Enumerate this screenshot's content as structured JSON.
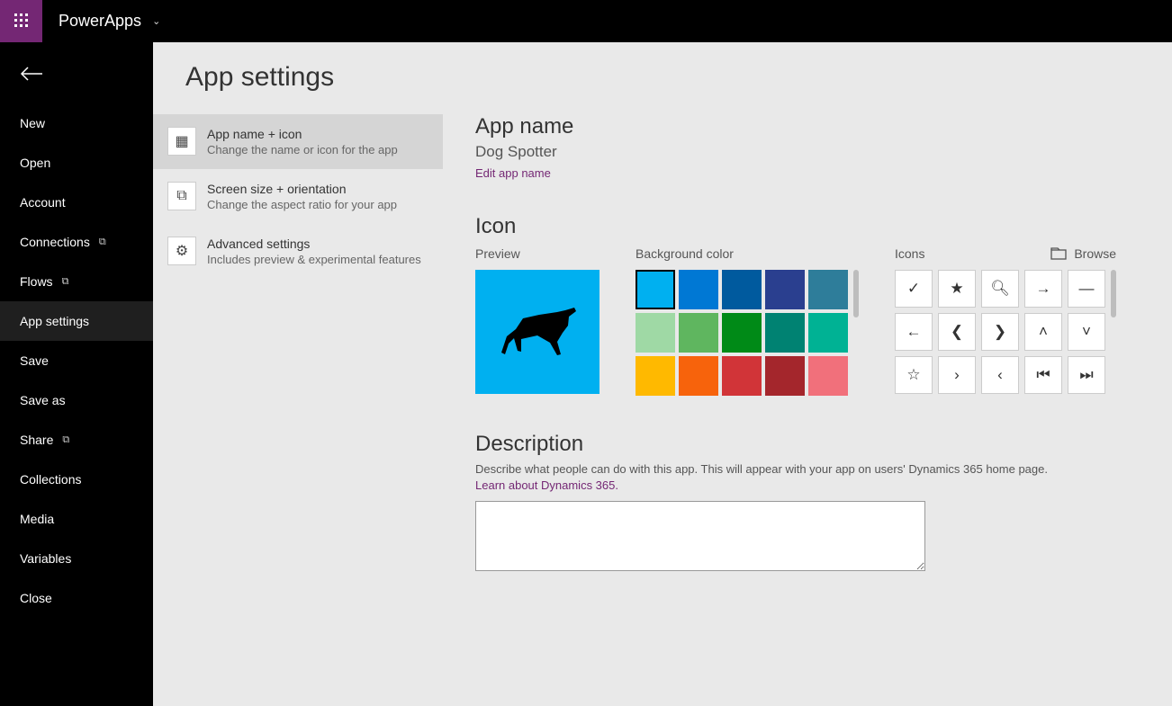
{
  "header": {
    "brand": "PowerApps"
  },
  "sidebar": {
    "items": [
      {
        "label": "New",
        "ext": false
      },
      {
        "label": "Open",
        "ext": false
      },
      {
        "label": "Account",
        "ext": false
      },
      {
        "label": "Connections",
        "ext": true
      },
      {
        "label": "Flows",
        "ext": true
      },
      {
        "label": "App settings",
        "ext": false,
        "active": true
      },
      {
        "label": "Save",
        "ext": false
      },
      {
        "label": "Save as",
        "ext": false
      },
      {
        "label": "Share",
        "ext": true
      },
      {
        "label": "Collections",
        "ext": false
      },
      {
        "label": "Media",
        "ext": false
      },
      {
        "label": "Variables",
        "ext": false
      },
      {
        "label": "Close",
        "ext": false
      }
    ]
  },
  "page": {
    "title": "App settings"
  },
  "settings": [
    {
      "title": "App name + icon",
      "desc": "Change the name or icon for the app",
      "active": true
    },
    {
      "title": "Screen size + orientation",
      "desc": "Change the aspect ratio for your app",
      "active": false
    },
    {
      "title": "Advanced settings",
      "desc": "Includes preview & experimental features",
      "active": false
    }
  ],
  "detail": {
    "appName": {
      "heading": "App name",
      "value": "Dog Spotter",
      "editLink": "Edit app name"
    },
    "icon": {
      "heading": "Icon",
      "previewLabel": "Preview",
      "bgLabel": "Background color",
      "iconsLabel": "Icons",
      "browseLabel": "Browse",
      "colors": [
        "#00b0f0",
        "#0078d4",
        "#005a9e",
        "#2a3f8f",
        "#2e7d9a",
        "#9fd9a5",
        "#5fb65f",
        "#008a17",
        "#008272",
        "#00b294",
        "#ffb900",
        "#f7630c",
        "#d13438",
        "#a4262c",
        "#f1707b"
      ],
      "icons": [
        "check",
        "star",
        "search",
        "arrow-right",
        "minus",
        "arrow-left",
        "chevron-left",
        "chevron-right",
        "chevron-up",
        "chevron-down",
        "star-outline",
        "angle-right",
        "angle-left",
        "skip-prev",
        "skip-next"
      ]
    },
    "description": {
      "heading": "Description",
      "help": "Describe what people can do with this app. This will appear with your app on users' Dynamics 365 home page.",
      "learnLink": "Learn about Dynamics 365.",
      "value": ""
    }
  }
}
